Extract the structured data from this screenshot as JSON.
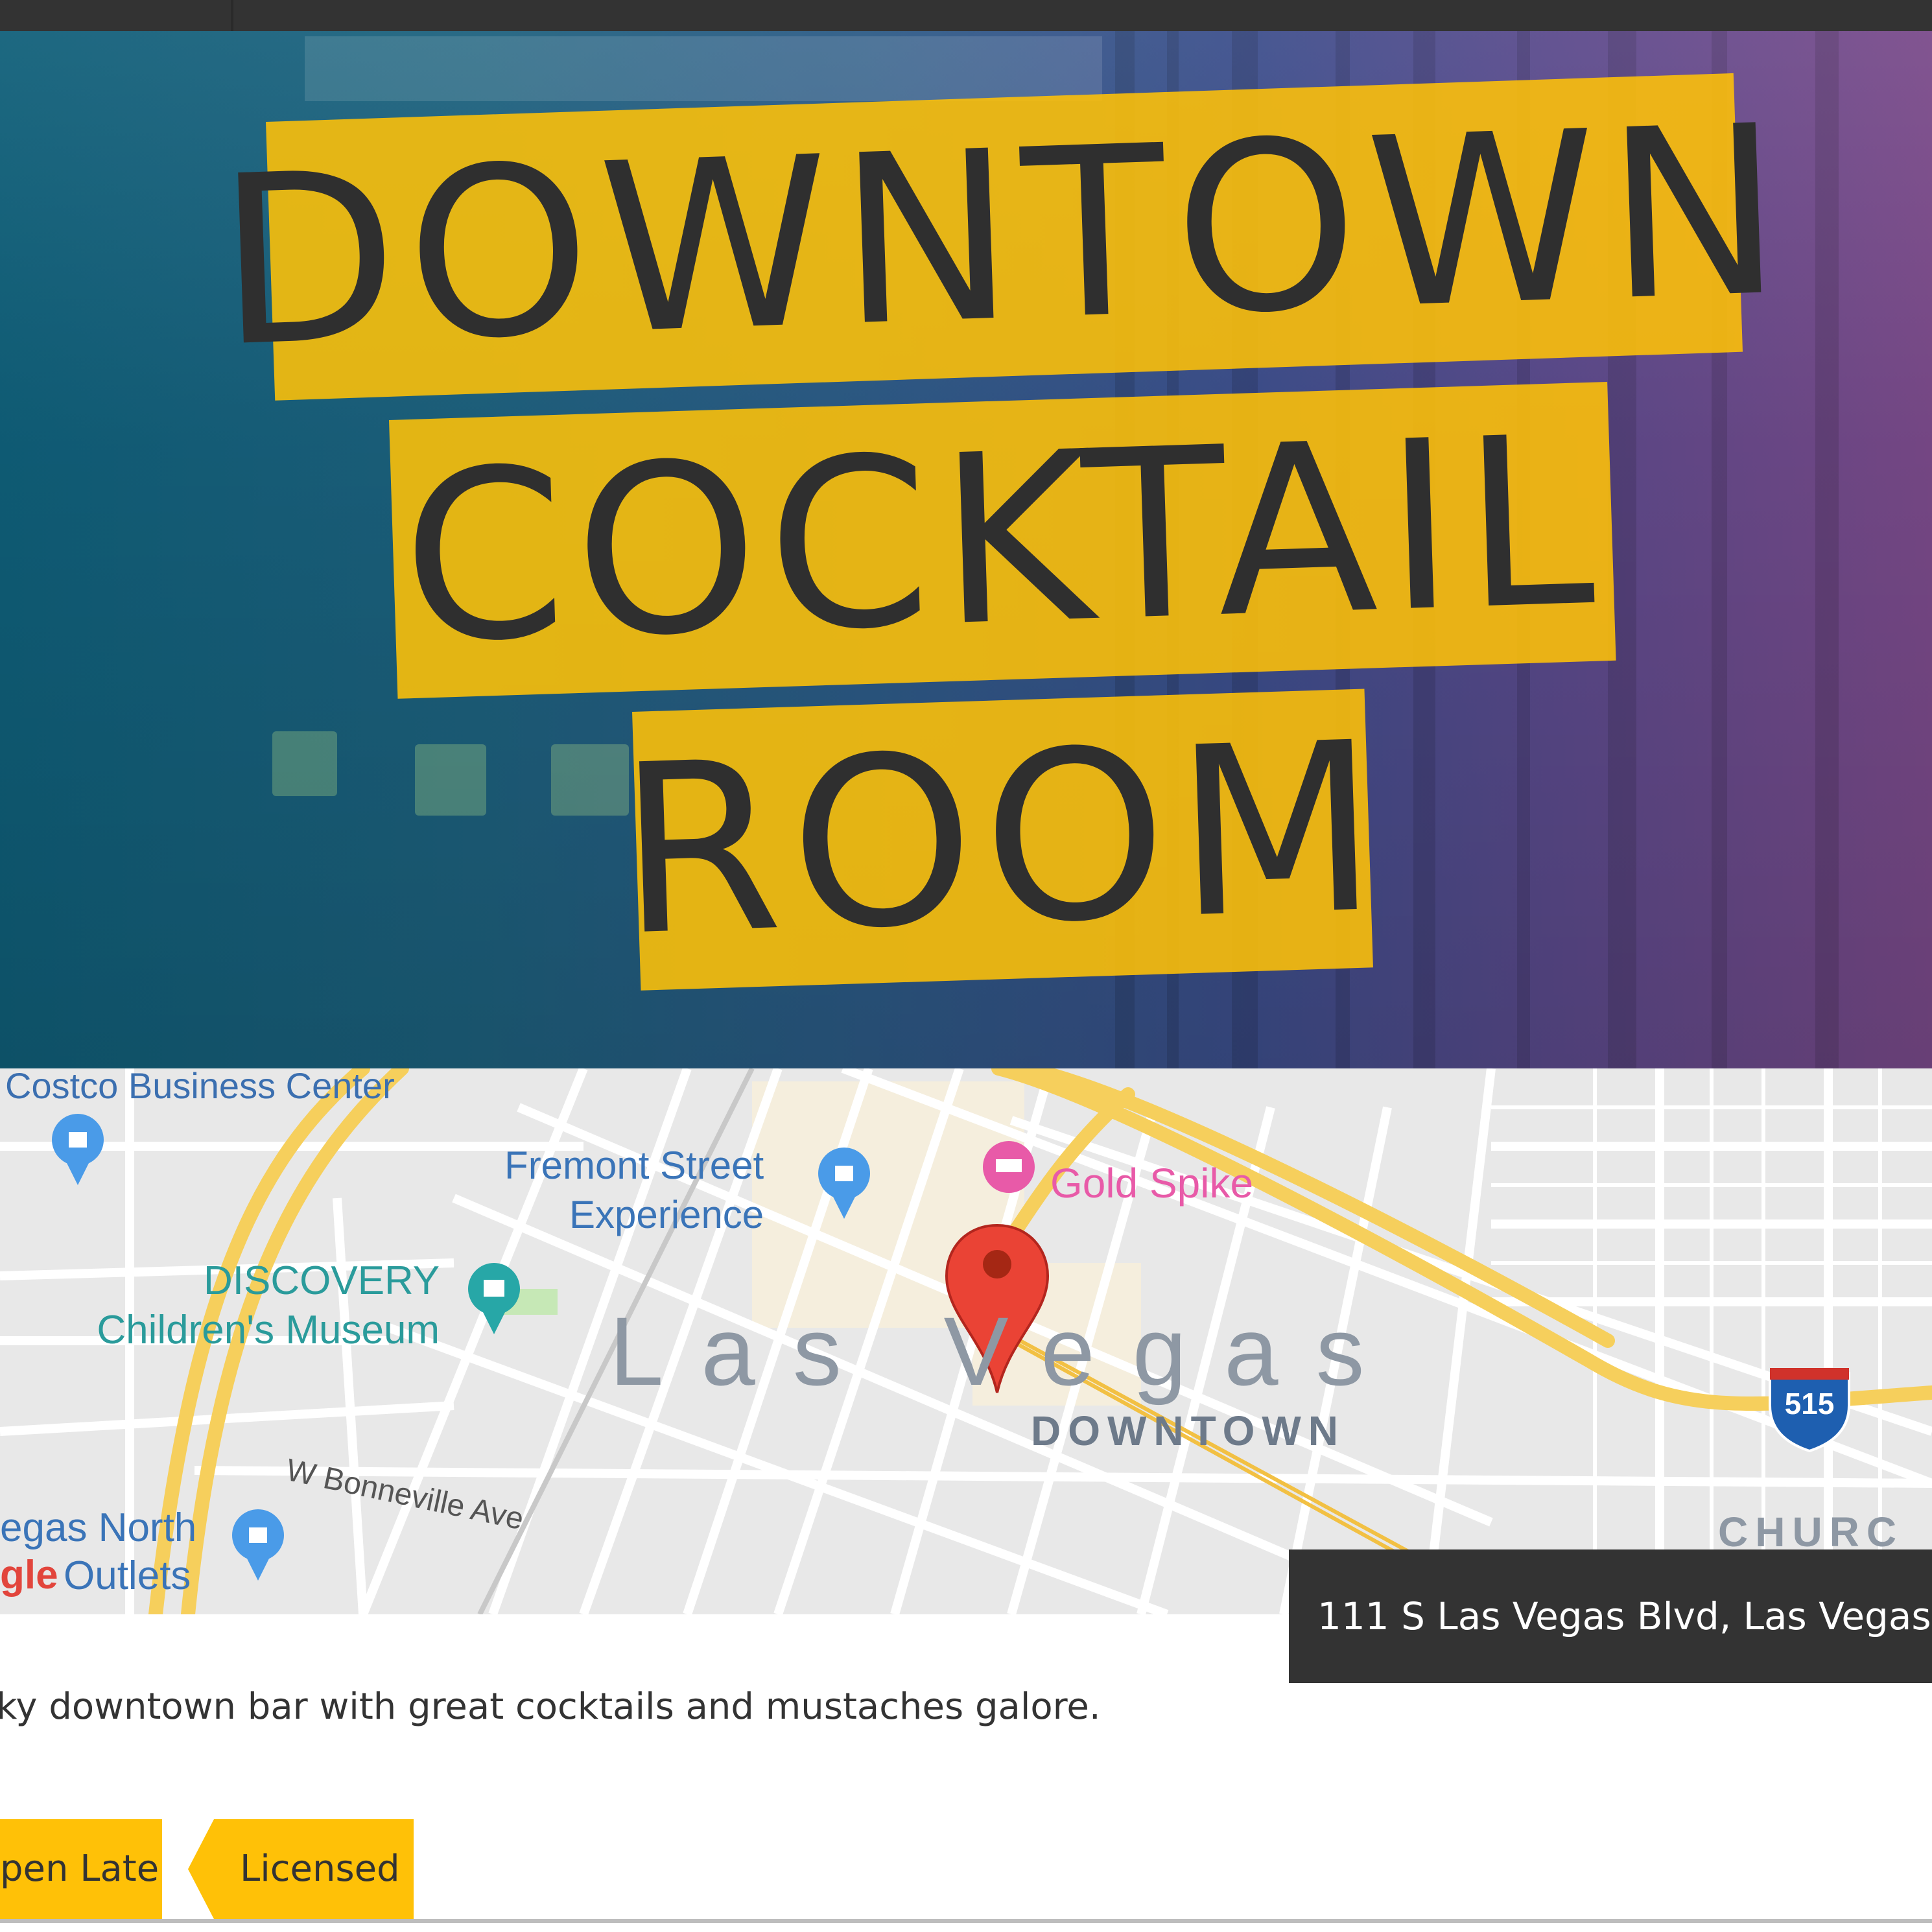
{
  "hero": {
    "title_lines": [
      "DOWNTOWN",
      "COCKTAIL",
      "ROOM"
    ],
    "accent_color": "#ffc107"
  },
  "map": {
    "labels": {
      "costco": "Costco Business Center",
      "fremont_line1": "Fremont Street",
      "fremont_line2": "Experience",
      "gold_spike": "Gold Spike",
      "discovery_line1": "DISCOVERY",
      "discovery_line2": "Children's Museum",
      "city": "Las Vegas",
      "district": "DOWNTOWN",
      "street": "W Bonneville Ave",
      "church": "CHURC",
      "outlets_line1": "egas North",
      "outlets_line2": "Outlets",
      "google_fragment": "gle",
      "highway": "515"
    },
    "pin_icon": "map-pin-icon",
    "address": "111 S Las Vegas Blvd, Las Vegas, N"
  },
  "description": "ky downtown bar with great cocktails and mustaches galore.",
  "tags": [
    "pen Late",
    "Licensed"
  ]
}
